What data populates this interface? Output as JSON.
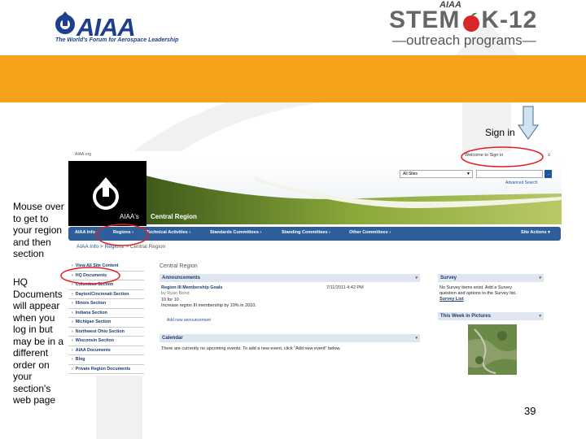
{
  "logos": {
    "aiaa": {
      "wordmark": "AIAA",
      "tagline": "The World's Forum for Aerospace Leadership"
    },
    "stem": {
      "small": "AIAA",
      "main_left": "STEM",
      "main_right": "K-12",
      "sub": "—outreach programs—"
    }
  },
  "colors": {
    "orange_band": "#f7a21b",
    "nav_blue": "#2f5f9b",
    "ellipse_red": "#e02020"
  },
  "callouts": {
    "sign_in": "Sign in",
    "mouse_over": "Mouse over to get to your region and then section",
    "hq_documents_note": "HQ Documents will appear when you log in but may be in a different order on your section's web page"
  },
  "page_number": "39",
  "site": {
    "top_link": "AIAA.org",
    "sign_in_link": "Welcome to Sign in",
    "close_icon": "x",
    "search_scope": "All Sites",
    "search_go": "→",
    "advanced_search": "Advanced Search",
    "logo_caption": "AIAA's",
    "banner_title": "Central Region",
    "nav": [
      {
        "label": "AIAA Info",
        "icon": "chevron-right"
      },
      {
        "label": "Regions",
        "icon": "chevron-right"
      },
      {
        "label": "Technical Activities",
        "icon": "chevron-right"
      },
      {
        "label": "Standards Committees",
        "icon": "chevron-right"
      },
      {
        "label": "Standing Committees",
        "icon": "chevron-right"
      },
      {
        "label": "Other Committees",
        "icon": "chevron-right"
      },
      {
        "label": "Site Actions",
        "icon": "chevron-down"
      }
    ],
    "breadcrumb": {
      "root": "AIAA Info",
      "sep1": " > ",
      "mid": "Regions",
      "sep2": " > ",
      "current": "Central Region"
    },
    "left_nav": [
      "View All Site Content",
      "HQ Documents",
      "Columbus Section",
      "Dayton/Cincinnati Section",
      "Illinois Section",
      "Indiana Section",
      "Michigan Section",
      "Northwest Ohio Section",
      "Wisconsin Section",
      "AIAA Documents",
      "Blog",
      "Private Region Documents"
    ],
    "page_heading": "Central Region",
    "announcements": {
      "title": "Announcements",
      "item_title": "Region III Membership Goals",
      "item_date": "7/11/2011 4:42 PM",
      "item_by": "by Ryan Bond",
      "item_line1": "10 for 10",
      "item_line2": "Increase region III membership by 10% in 2010.",
      "add_link": "Add new announcement"
    },
    "calendar": {
      "title": "Calendar",
      "text": "There are currently no upcoming events. To add a new event, click \"Add new event\" below."
    },
    "survey": {
      "title": "Survey",
      "text_line1": "No Survey items exist. Add a Survey",
      "text_line2": "question and options to the Survey list.",
      "link": "Survey List"
    },
    "pictures": {
      "title": "This Week in Pictures"
    }
  }
}
